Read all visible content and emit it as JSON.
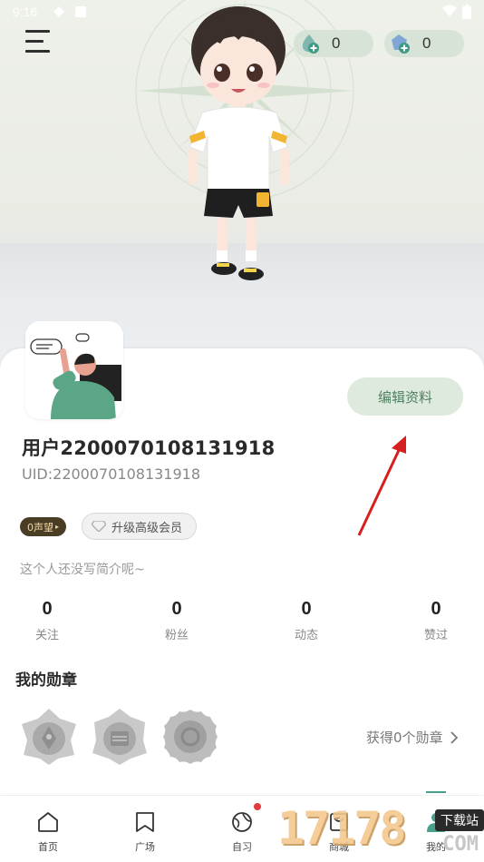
{
  "status_bar": {
    "time": "9:16"
  },
  "currency": {
    "shells": "0",
    "diamonds": "0"
  },
  "profile": {
    "edit_label": "编辑资料",
    "username": "用户2200070108131918",
    "uid": "UID:2200070108131918",
    "reputation_badge": "0声望",
    "vip_label": "升级高级会员",
    "bio": "这个人还没写简介呢~"
  },
  "stats": [
    {
      "value": "0",
      "label": "关注"
    },
    {
      "value": "0",
      "label": "粉丝"
    },
    {
      "value": "0",
      "label": "动态"
    },
    {
      "value": "0",
      "label": "赞过"
    }
  ],
  "medals": {
    "title": "我的勋章",
    "link_label": "获得0个勋章"
  },
  "tabbar": [
    {
      "label": "首页",
      "icon": "home-icon"
    },
    {
      "label": "广场",
      "icon": "bookmark-icon"
    },
    {
      "label": "自习",
      "icon": "planet-icon"
    },
    {
      "label": "商城",
      "icon": "shop-icon"
    },
    {
      "label": "我的",
      "icon": "profile-icon"
    }
  ],
  "watermark": {
    "number": "17178",
    "tag": "下载站",
    "domain": ".COM"
  },
  "colors": {
    "accent": "#48a08a",
    "edit_button_bg": "#deeadd",
    "edit_button_text": "#4f8062",
    "reputation_bg": "#4a3d26",
    "annotation_arrow": "#d61f1f"
  }
}
